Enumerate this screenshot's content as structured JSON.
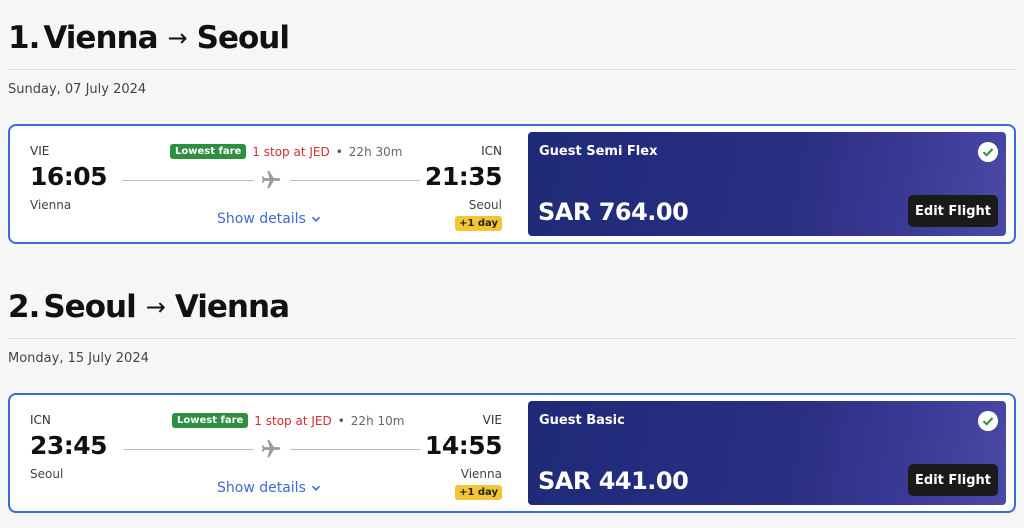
{
  "flights": [
    {
      "heading": {
        "number": "1.",
        "from": "Vienna",
        "arrow": "→",
        "to": "Seoul"
      },
      "date": "Sunday, 07 July 2024",
      "departure": {
        "code": "VIE",
        "time": "16:05",
        "city": "Vienna"
      },
      "arrival": {
        "code": "ICN",
        "time": "21:35",
        "city": "Seoul",
        "day_offset": "+1 day"
      },
      "badge": "Lowest fare",
      "stops": "1 stop at JED",
      "separator": "•",
      "duration": "22h 30m",
      "details_link": "Show details",
      "fare": {
        "name": "Guest Semi Flex",
        "price": "SAR 764.00",
        "edit_label": "Edit Flight"
      }
    },
    {
      "heading": {
        "number": "2.",
        "from": "Seoul",
        "arrow": "→",
        "to": "Vienna"
      },
      "date": "Monday, 15 July 2024",
      "departure": {
        "code": "ICN",
        "time": "23:45",
        "city": "Seoul"
      },
      "arrival": {
        "code": "VIE",
        "time": "14:55",
        "city": "Vienna",
        "day_offset": "+1 day"
      },
      "badge": "Lowest fare",
      "stops": "1 stop at JED",
      "separator": "•",
      "duration": "22h 10m",
      "details_link": "Show details",
      "fare": {
        "name": "Guest Basic",
        "price": "SAR 441.00",
        "edit_label": "Edit Flight"
      }
    }
  ],
  "colors": {
    "accent": "#3c6bd6",
    "badge_green": "#2d8f3f",
    "stop_red": "#cf2f2f",
    "day_yellow": "#f3c534",
    "fare_panel": "#1e2a78"
  },
  "icons": {
    "arrow": "arrow-right-icon",
    "plane": "plane-icon",
    "chevron": "chevron-down-icon",
    "check": "check-circle-icon"
  }
}
